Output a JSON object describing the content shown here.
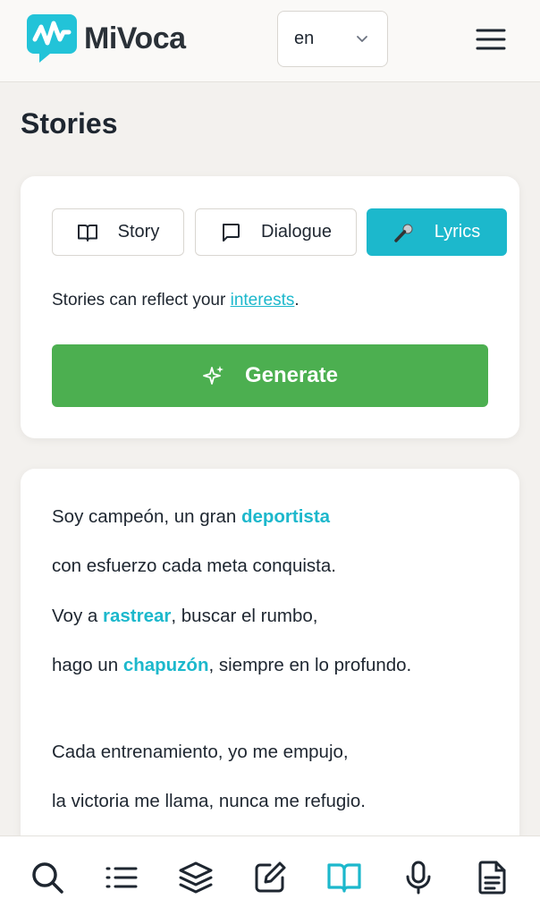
{
  "header": {
    "logo_text": "MiVoca",
    "language": "en",
    "menu_icon": "hamburger-menu-icon"
  },
  "page": {
    "title": "Stories"
  },
  "modes": {
    "story": {
      "label": "Story",
      "icon": "book-open-icon"
    },
    "dialogue": {
      "label": "Dialogue",
      "icon": "speech-bubble-icon"
    },
    "lyrics": {
      "label": "Lyrics",
      "icon": "microphone-icon",
      "selected": true
    }
  },
  "hint": {
    "prefix": "Stories can reflect your ",
    "link": "interests",
    "suffix": "."
  },
  "generate": {
    "label": "Generate",
    "icon": "sparkles-icon"
  },
  "lyrics": {
    "lines": [
      {
        "before": "Soy campeón, un gran ",
        "word": "deportista",
        "after": ""
      },
      {
        "before": "con esfuerzo cada meta conquista.",
        "word": "",
        "after": ""
      },
      {
        "before": "Voy a ",
        "word": "rastrear",
        "after": ", buscar el rumbo,"
      },
      {
        "before": "hago un ",
        "word": "chapuzón",
        "after": ", siempre en lo profundo."
      },
      {
        "before": "Cada entrenamiento, yo me empujo,",
        "word": "",
        "after": ""
      },
      {
        "before": "la victoria me llama, nunca me refugio.",
        "word": "",
        "after": ""
      }
    ]
  },
  "bottom_nav": [
    {
      "icon": "search-icon"
    },
    {
      "icon": "list-icon"
    },
    {
      "icon": "layers-icon"
    },
    {
      "icon": "edit-icon"
    },
    {
      "icon": "book-open-icon",
      "active": true
    },
    {
      "icon": "microphone-icon"
    },
    {
      "icon": "document-icon"
    }
  ],
  "colors": {
    "accent": "#1cb8cc",
    "generate": "#4caf50",
    "text": "#1e2630",
    "background": "#f3f1ee"
  }
}
